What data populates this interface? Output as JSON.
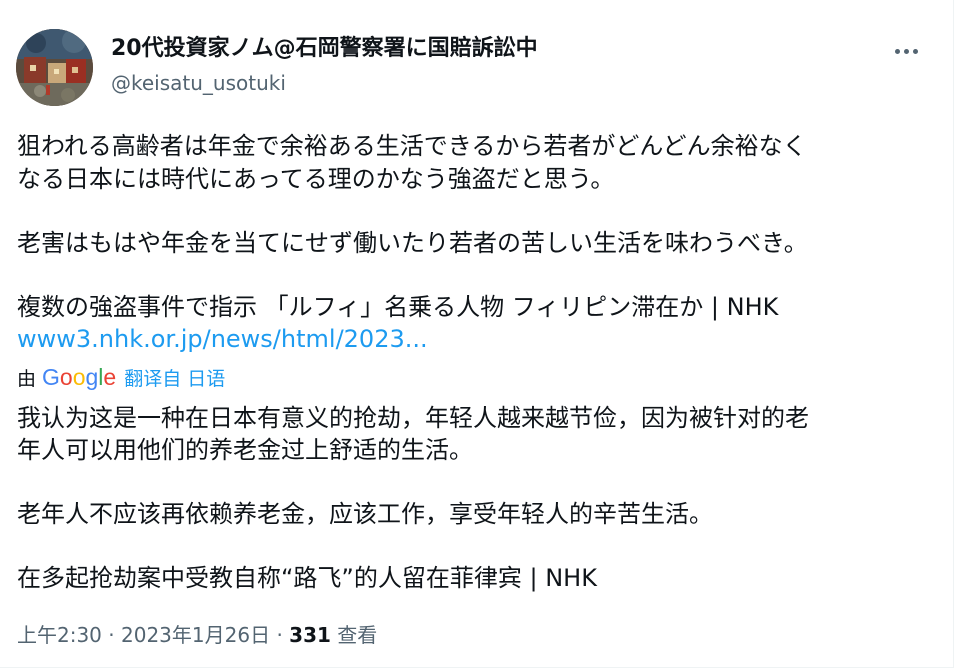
{
  "author": {
    "name": "20代投資家ノム@石岡警察署に国賠訴訟中",
    "handle": "@keisatu_usotuki"
  },
  "tweet": {
    "original_lines": [
      "狙われる高齢者は年金で余裕ある生活できるから若者がどんどん余裕なく",
      "なる日本には時代にあってる理のかなう強盗だと思う。",
      "老害はもはや年金を当てにせず働いたり若者の苦しい生活を味わうべき。",
      "複数の強盗事件で指示 「ルフィ」名乗る人物 フィリピン滞在か | NHK"
    ],
    "link": "www3.nhk.or.jp/news/html/2023..."
  },
  "translation": {
    "prefix": "由",
    "google_letters": [
      "G",
      "o",
      "o",
      "g",
      "l",
      "e"
    ],
    "google_colors": [
      "#4285F4",
      "#EA4335",
      "#FBBC05",
      "#4285F4",
      "#34A853",
      "#EA4335"
    ],
    "label": "翻译自 日语",
    "lines": [
      "我认为这是一种在日本有意义的抢劫，年轻人越来越节俭，因为被针对的老",
      "年人可以用他们的养老金过上舒适的生活。",
      "老年人不应该再依赖养老金，应该工作，享受年轻人的辛苦生活。",
      "在多起抢劫案中受教自称“路飞”的人留在菲律宾 | NHK"
    ]
  },
  "meta": {
    "time": "上午2:30",
    "separator": "·",
    "date": "2023年1月26日",
    "views_count": "331",
    "views_label": "查看"
  },
  "colors": {
    "text": "#0f1419",
    "secondary": "#536471",
    "link": "#1d9bf0"
  },
  "icons": {
    "more": "more-horizontal-icon"
  }
}
